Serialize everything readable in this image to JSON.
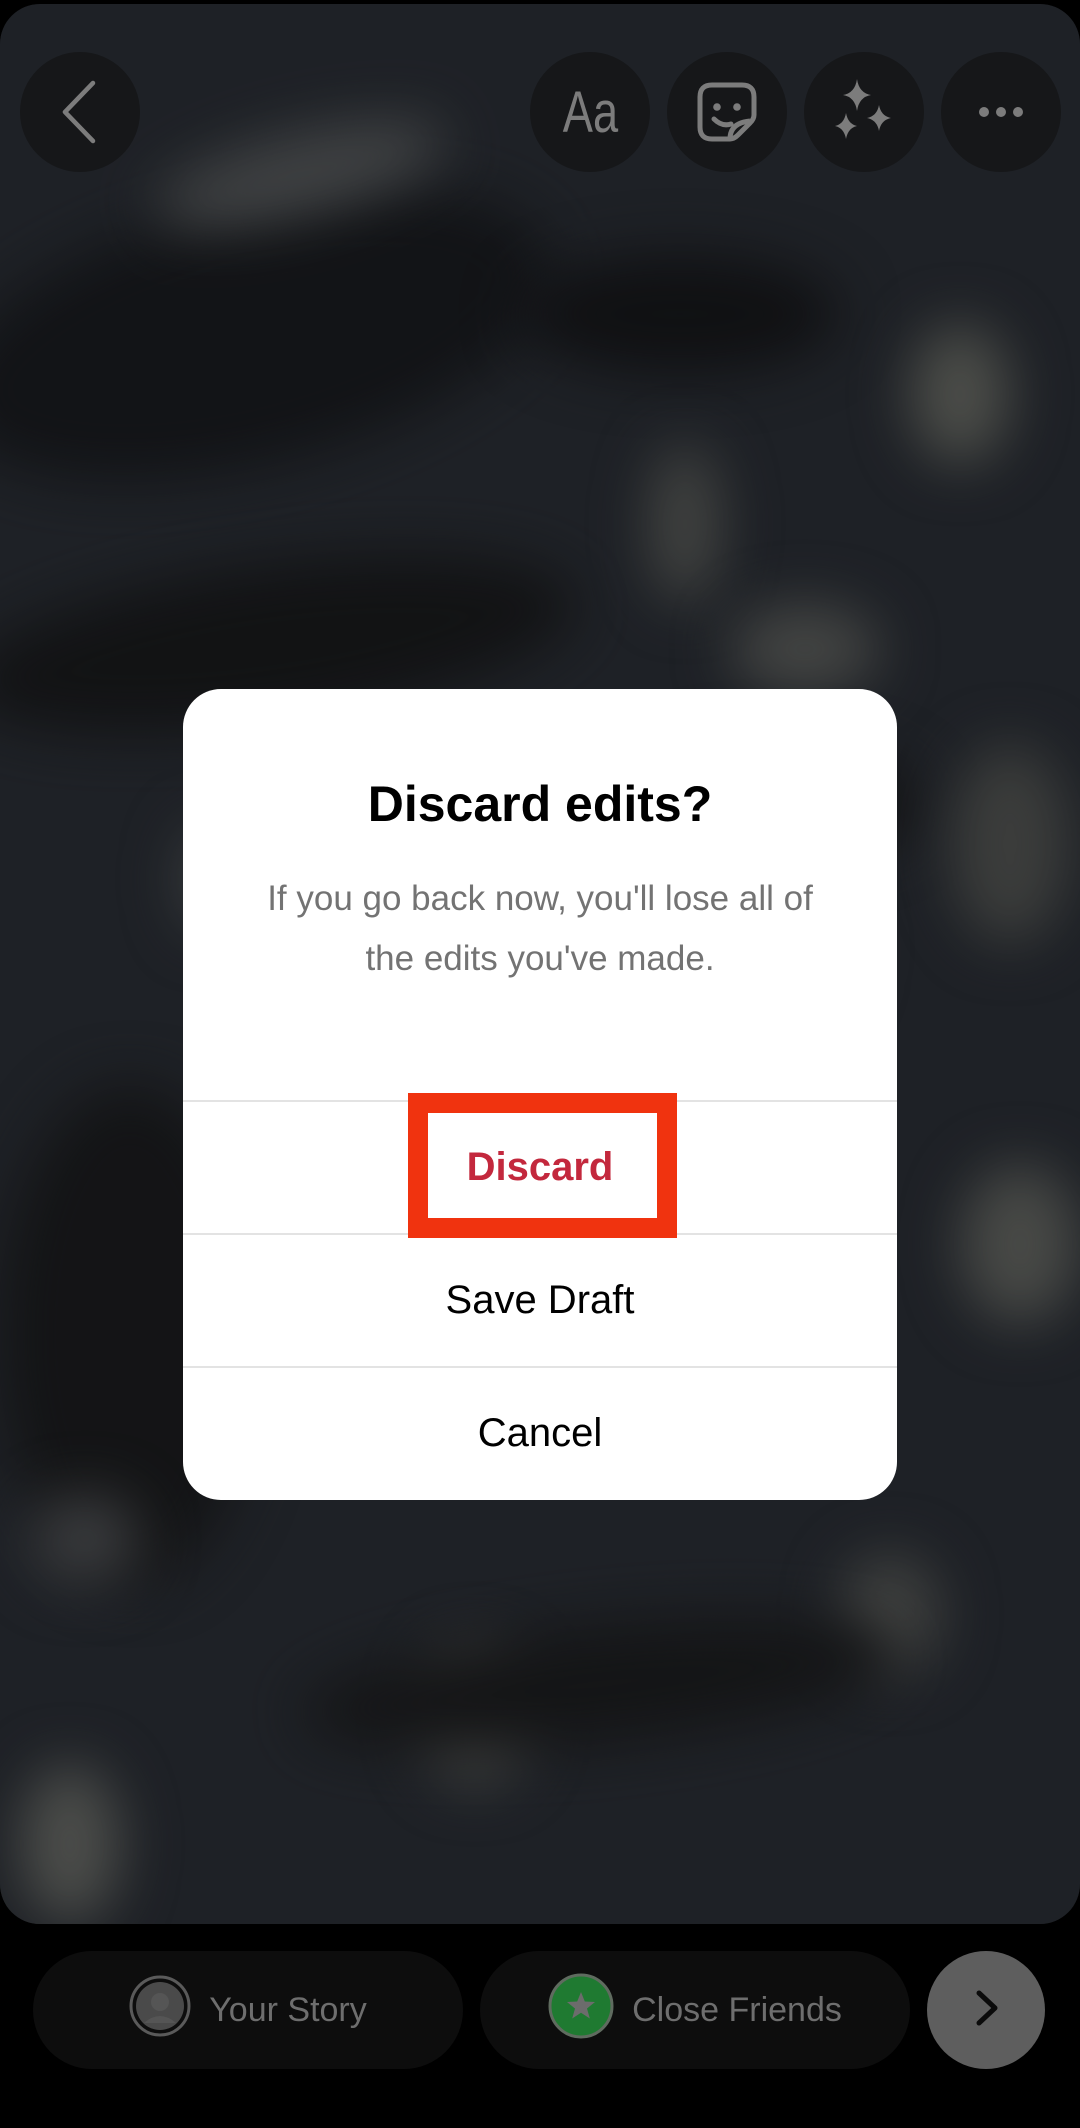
{
  "toolbar": {
    "back_icon": "chevron-left-icon",
    "text_tool": {
      "label": "Aa",
      "icon": "text-icon"
    },
    "sticker_tool": {
      "icon": "sticker-icon"
    },
    "effects_tool": {
      "icon": "sparkles-icon"
    },
    "more_tool": {
      "icon": "more-horizontal-icon"
    }
  },
  "dialog": {
    "title": "Discard edits?",
    "message": "If you go back now, you'll lose all of the edits you've made.",
    "actions": [
      {
        "label": "Discard",
        "style": "destructive",
        "highlighted": true
      },
      {
        "label": "Save Draft",
        "style": "default"
      },
      {
        "label": "Cancel",
        "style": "default"
      }
    ]
  },
  "share_bar": {
    "your_story": {
      "label": "Your Story",
      "icon": "avatar-icon"
    },
    "close_friends": {
      "label": "Close Friends",
      "icon": "star-icon",
      "color": "#1f7a31"
    },
    "next_icon": "chevron-right-icon"
  },
  "colors": {
    "destructive": "#c3283d",
    "highlight_box": "#f0330f",
    "close_friends_green": "#1f7a31"
  }
}
